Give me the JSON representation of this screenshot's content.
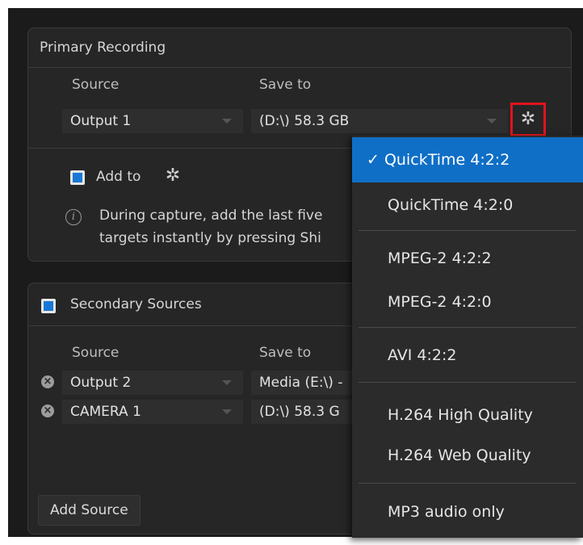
{
  "primary": {
    "title": "Primary Recording",
    "source_label": "Source",
    "saveto_label": "Save to",
    "source_value": "Output 1",
    "saveto_value": "(D:\\) 58.3 GB",
    "add_to_label": "Add to",
    "info_line1": "During capture, add the last five",
    "info_line2": "targets instantly by pressing Shi"
  },
  "secondary": {
    "title": "Secondary Sources",
    "source_label": "Source",
    "saveto_label": "Save to",
    "rows": [
      {
        "source": "Output 2",
        "saveto": "Media (E:\\) -"
      },
      {
        "source": "CAMERA 1",
        "saveto": "(D:\\) 58.3 G"
      }
    ],
    "add_source_label": "Add Source"
  },
  "format_menu": {
    "checkmark": "✓",
    "items": [
      "QuickTime 4:2:2",
      "QuickTime 4:2:0",
      "MPEG-2 4:2:2",
      "MPEG-2 4:2:0",
      "AVI 4:2:2",
      "H.264 High Quality",
      "H.264 Web Quality",
      "MP3 audio only"
    ],
    "selected": "QuickTime 4:2:2"
  },
  "icons": {
    "settings": "gear-icon",
    "info": "info-icon",
    "remove": "remove-icon"
  },
  "colors": {
    "accent": "#0f6fc6",
    "highlight_box": "#e0141e",
    "background": "#1b1b1b"
  }
}
